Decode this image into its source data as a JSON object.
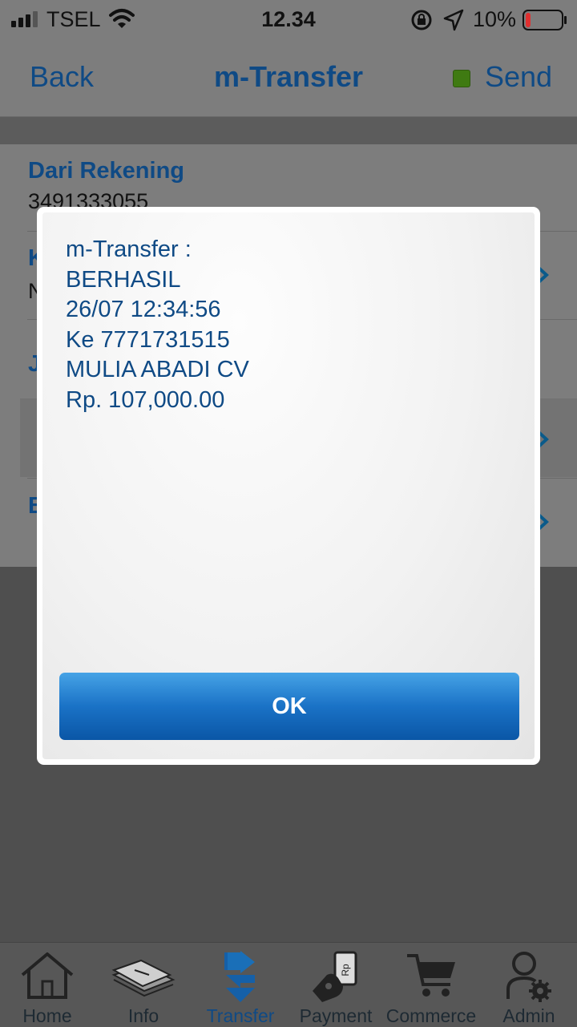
{
  "status_bar": {
    "carrier": "TSEL",
    "time": "12.34",
    "battery_percent": "10%",
    "battery_level": 0.1,
    "battery_color": "#e03030"
  },
  "nav_bar": {
    "back_label": "Back",
    "title": "m-Transfer",
    "send_label": "Send",
    "status_color": "#3f7a12"
  },
  "form": {
    "rows": [
      {
        "label": "Dari Rekening",
        "value": "3491333055"
      },
      {
        "label": "K",
        "value": "N"
      },
      {
        "label": "J",
        "value": ""
      },
      {
        "label": "B",
        "value": ""
      }
    ]
  },
  "dialog": {
    "lines": [
      "m-Transfer :",
      "BERHASIL",
      "26/07 12:34:56",
      "Ke 7771731515",
      "MULIA ABADI CV",
      "Rp. 107,000.00"
    ],
    "ok_label": "OK"
  },
  "tab_bar": {
    "active": "Transfer",
    "items": [
      {
        "label": "Home",
        "icon": "house-icon"
      },
      {
        "label": "Info",
        "icon": "documents-icon"
      },
      {
        "label": "Transfer",
        "icon": "transfer-arrows-icon"
      },
      {
        "label": "Payment",
        "icon": "payment-hand-icon"
      },
      {
        "label": "Commerce",
        "icon": "shopping-cart-icon"
      },
      {
        "label": "Admin",
        "icon": "user-gear-icon"
      }
    ]
  },
  "colors": {
    "accent": "#0f4a85",
    "button_gradient_top": "#46a3e6",
    "button_gradient_bottom": "#0a56a6",
    "overlay": "#4f4f4f"
  }
}
